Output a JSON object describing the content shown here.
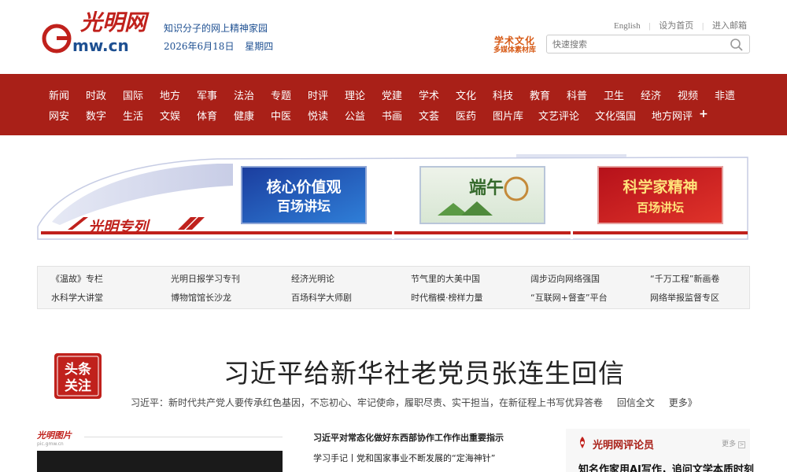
{
  "header": {
    "slogan": "知识分子的网上精神家园",
    "date": "2026年6月18日",
    "weekday": "星期四",
    "links": [
      "English",
      "设为首页",
      "进入邮箱"
    ],
    "xswh_line1": "学术文化",
    "xswh_line2": "多媒体素材库",
    "search_placeholder": "快速搜索"
  },
  "nav": {
    "row1": [
      "新闻",
      "时政",
      "国际",
      "地方",
      "军事",
      "法治",
      "专题",
      "时评",
      "理论",
      "党建",
      "学术",
      "文化",
      "科技",
      "教育",
      "科普",
      "卫生",
      "经济",
      "视频",
      "非遗"
    ],
    "row2": [
      "网安",
      "数字",
      "生活",
      "文娱",
      "体育",
      "健康",
      "中医",
      "悦读",
      "公益",
      "书画",
      "文荟",
      "医药",
      "图片库",
      "文艺评论",
      "文化强国",
      "地方网评"
    ],
    "plus": "+"
  },
  "banner": {
    "train_label": "光明专列",
    "card1_line1": "核心价值观",
    "card1_line2": "百场讲坛",
    "card2_text": "端午",
    "card3_line1": "科学家精神",
    "card3_line2": "百场讲坛"
  },
  "quicklinks": {
    "row1": [
      "《温故》专栏",
      "光明日报学习专刊",
      "经济光明论",
      "节气里的大美中国",
      "阔步迈向网络强国",
      "“千万工程”新画卷"
    ],
    "row2": [
      "水科学大讲堂",
      "博物馆馆长沙龙",
      "百场科学大师剧",
      "时代楷模·榜样力量",
      "“互联网+督查”平台",
      "网络举报监督专区"
    ]
  },
  "headline": {
    "badge": [
      "头条",
      "关注"
    ],
    "title": "习近平给新华社老党员张连生回信",
    "sub": "习近平：新时代共产党人要传承红色基因，不忘初心、牢记使命，履职尽责、实干担当，在新征程上书写优异答卷",
    "sub_link1": "回信全文",
    "sub_link2": "更多》"
  },
  "pictures": {
    "logo": "光明图片",
    "logo_sub": "pic.gmw.cn"
  },
  "news": {
    "item1": "习近平对常态化做好东西部协作工作作出重要指示",
    "item2": "学习手记丨党和国家事业不断发展的“定海神针”"
  },
  "comment": {
    "title": "光明网评论员",
    "more": "更多",
    "headline": "知名作家用AI写作，追问文学本质时刻"
  },
  "colors": {
    "nav_bg": "#a92018",
    "brand_red": "#c0211c",
    "link_blue": "#1d4f91",
    "xswh_orange": "#d75a16"
  }
}
